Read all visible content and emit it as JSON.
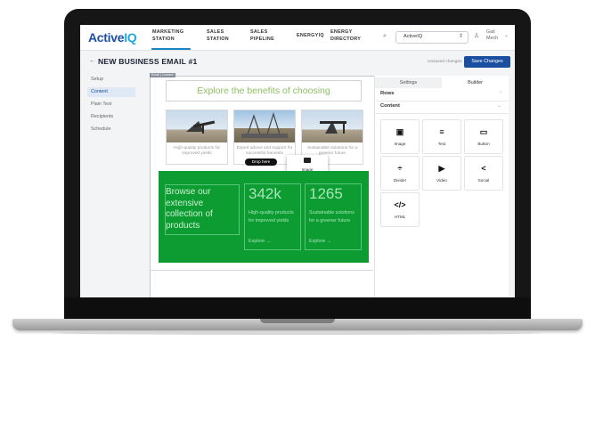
{
  "header": {
    "logo_main": "Active",
    "logo_accent": "IQ",
    "nav": [
      {
        "line1": "MARKETING",
        "line2": "STATION"
      },
      {
        "line1": "SALES",
        "line2": "STATION"
      },
      {
        "line1": "SALES",
        "line2": "PIPELINE"
      },
      {
        "line1": "ENERGYIQ",
        "line2": ""
      },
      {
        "line1": "ENERGY",
        "line2": "DIRECTORY"
      }
    ],
    "account_select": "ActiveIQ",
    "user_first": "Gail",
    "user_last": "Mech"
  },
  "page": {
    "back_arrow": "←",
    "title": "NEW BUSINESS EMAIL #1",
    "unsaved": "Unsaved changes",
    "save_label": "Save Changes"
  },
  "side_menu": [
    "Setup",
    "Content",
    "Plain Text",
    "Recipients",
    "Schedule"
  ],
  "canvas": {
    "email_tag": "Email | Content",
    "hero_title": "Explore the benefits of choosing",
    "cards": [
      "High-quality products for improved yields",
      "Expert advice and support for successful harvests",
      "Sustainable solutions for a greener future"
    ],
    "drop_here": "Drop here",
    "drag_item": "Image",
    "browse": "Browse our extensive collection of products",
    "stats": [
      {
        "num": "342k",
        "desc": "High-quality products for improved yields",
        "link": "Explore →"
      },
      {
        "num": "1265",
        "desc": "Sustainable solutions for a greener future",
        "link": "Explore →"
      }
    ]
  },
  "panel": {
    "tab_settings": "Settings",
    "tab_builder": "Builder",
    "rows_label": "Rows",
    "content_label": "Content",
    "blocks": [
      {
        "label": "Image",
        "icon": "image-icon"
      },
      {
        "label": "Text",
        "icon": "text-icon"
      },
      {
        "label": "Button",
        "icon": "button-icon"
      },
      {
        "label": "Divider",
        "icon": "divider-icon"
      },
      {
        "label": "Video",
        "icon": "video-icon"
      },
      {
        "label": "Social",
        "icon": "share-icon"
      },
      {
        "label": "HTML",
        "icon": "code-icon"
      }
    ]
  },
  "colors": {
    "brand": "#1d4fa3",
    "accent": "#20a8e0",
    "green_band": "#0d9c32",
    "save_button": "#1a4fa0"
  }
}
